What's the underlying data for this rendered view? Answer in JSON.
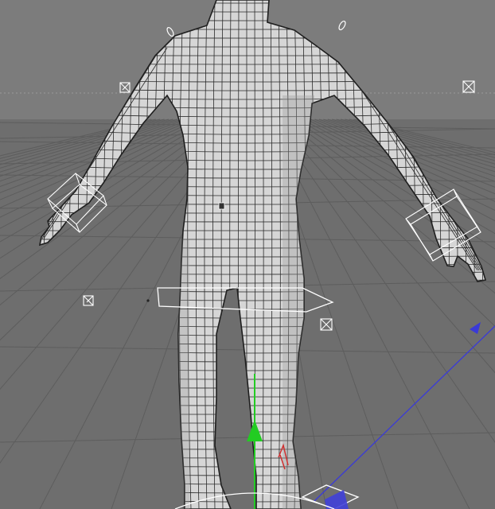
{
  "viewport": {
    "background_color": "#7a7a7a",
    "floor_grid_color": "#5f5f5f",
    "horizon_color": "#9a9a9a",
    "mesh_fill_color": "#d8d8d8",
    "mesh_wire_color": "#1e1e1e",
    "control_color": "#ffffff",
    "axis_y_color": "#22cc22",
    "axis_z_color": "#3a3ad8",
    "axis_x_color": "#d03030"
  },
  "scene": {
    "object": "character-mesh",
    "icons": [
      "character-mesh-icon",
      "ik-control-icon",
      "pole-target-icon",
      "move-gizmo-icon"
    ]
  }
}
